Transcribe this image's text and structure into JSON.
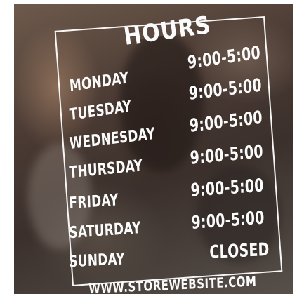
{
  "sign": {
    "title": "HOURS",
    "schedule": [
      {
        "day": "MONDAY",
        "hours": "9:00-5:00"
      },
      {
        "day": "TUESDAY",
        "hours": "9:00-5:00"
      },
      {
        "day": "WEDNESDAY",
        "hours": "9:00-5:00"
      },
      {
        "day": "THURSDAY",
        "hours": "9:00-5:00"
      },
      {
        "day": "FRIDAY",
        "hours": "9:00-5:00"
      },
      {
        "day": "SATURDAY",
        "hours": "9:00-5:00"
      },
      {
        "day": "SUNDAY",
        "hours": "CLOSED"
      }
    ],
    "website": "WWW.STOREWEBSITE.COM"
  },
  "colors": {
    "lettering": "#fbfbfb"
  }
}
